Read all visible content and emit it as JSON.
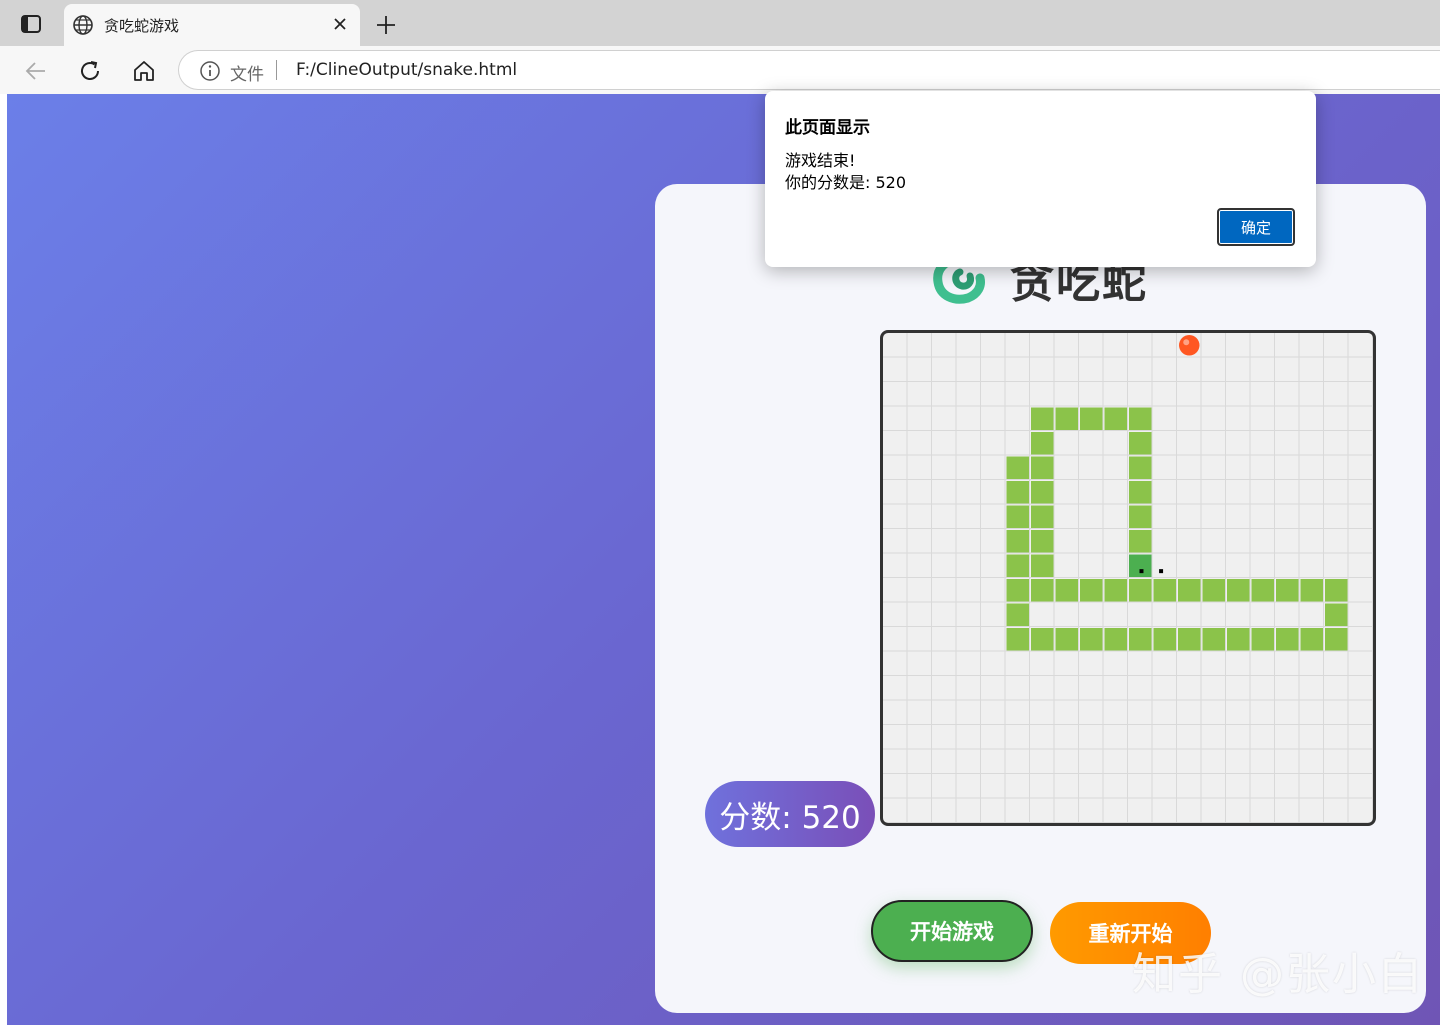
{
  "browser": {
    "tab_title": "贪吃蛇游戏",
    "address_prefix": "文件",
    "url": "F:/ClineOutput/snake.html"
  },
  "game": {
    "title": "贪吃蛇",
    "score_text": "分数: 520",
    "start_label": "开始游戏",
    "restart_label": "重新开始",
    "grid_size": 20,
    "food": [
      12,
      0
    ],
    "head": [
      10,
      9
    ],
    "snake_body": [
      [
        5,
        5
      ],
      [
        5,
        6
      ],
      [
        5,
        7
      ],
      [
        5,
        8
      ],
      [
        5,
        9
      ],
      [
        5,
        10
      ],
      [
        5,
        11
      ],
      [
        5,
        12
      ],
      [
        6,
        12
      ],
      [
        7,
        12
      ],
      [
        8,
        12
      ],
      [
        9,
        12
      ],
      [
        10,
        12
      ],
      [
        11,
        12
      ],
      [
        12,
        12
      ],
      [
        13,
        12
      ],
      [
        14,
        12
      ],
      [
        15,
        12
      ],
      [
        16,
        12
      ],
      [
        17,
        12
      ],
      [
        18,
        12
      ],
      [
        18,
        11
      ],
      [
        18,
        10
      ],
      [
        17,
        10
      ],
      [
        16,
        10
      ],
      [
        15,
        10
      ],
      [
        14,
        10
      ],
      [
        13,
        10
      ],
      [
        12,
        10
      ],
      [
        11,
        10
      ],
      [
        10,
        10
      ],
      [
        9,
        10
      ],
      [
        8,
        10
      ],
      [
        7,
        10
      ],
      [
        6,
        10
      ],
      [
        6,
        9
      ],
      [
        6,
        8
      ],
      [
        6,
        7
      ],
      [
        6,
        6
      ],
      [
        6,
        5
      ],
      [
        6,
        4
      ],
      [
        6,
        3
      ],
      [
        7,
        3
      ],
      [
        8,
        3
      ],
      [
        9,
        3
      ],
      [
        10,
        3
      ],
      [
        10,
        4
      ],
      [
        10,
        5
      ],
      [
        10,
        6
      ],
      [
        10,
        7
      ],
      [
        10,
        8
      ]
    ],
    "colors": {
      "body": "#8bc34a",
      "head": "#4caf50",
      "food": "#ff5722"
    }
  },
  "dialog": {
    "title": "此页面显示",
    "line1": "游戏结束!",
    "line2": "你的分数是: 520",
    "ok_label": "确定"
  },
  "watermark": "知乎 @张小白"
}
